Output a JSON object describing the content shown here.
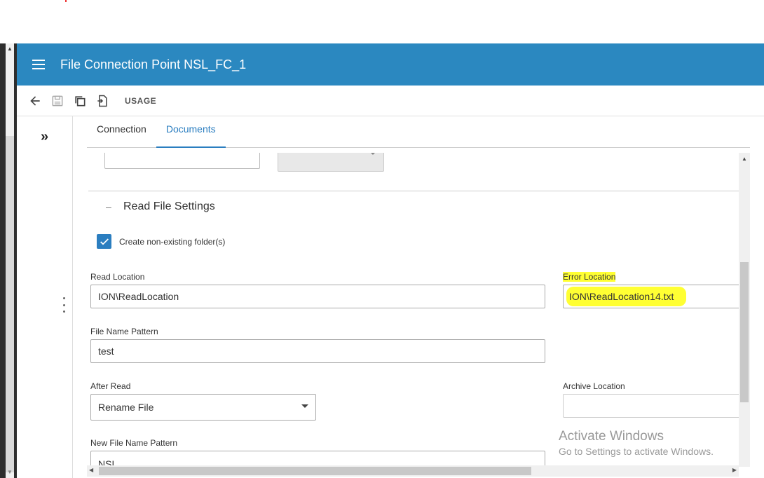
{
  "header": {
    "title": "File Connection Point NSL_FC_1"
  },
  "toolbar": {
    "usage_label": "USAGE"
  },
  "tabs": [
    {
      "label": "Connection",
      "active": false
    },
    {
      "label": "Documents",
      "active": true
    }
  ],
  "section": {
    "toggle": "–",
    "title": "Read File Settings",
    "create_folders": {
      "label": "Create non-existing folder(s)",
      "checked": true
    }
  },
  "fields": {
    "read_location": {
      "label": "Read Location",
      "value": "ION\\ReadLocation"
    },
    "error_location": {
      "label": "Error Location",
      "value": "ION\\ReadLocation14.txt"
    },
    "file_name_pattern": {
      "label": "File Name Pattern",
      "value": "test"
    },
    "after_read": {
      "label": "After Read",
      "value": "Rename File"
    },
    "archive_location": {
      "label": "Archive Location",
      "value": ""
    },
    "new_file_name_pattern": {
      "label": "New File Name Pattern",
      "value": "NSL"
    }
  },
  "watermark": {
    "line1": "Activate Windows",
    "line2": "Go to Settings to activate Windows."
  },
  "colors": {
    "header": "#2b88c0",
    "accent": "#2b7ec0",
    "highlight": "#ffff33"
  }
}
